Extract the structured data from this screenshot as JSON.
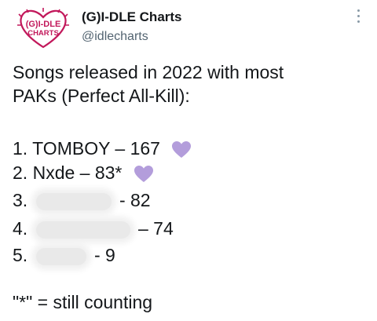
{
  "profile": {
    "display_name": "(G)I-DLE Charts",
    "handle": "@idlecharts",
    "avatar_text_line1": "(G)I-DLE",
    "avatar_text_line2": "CHARTS"
  },
  "tweet": {
    "headline_line1": "Songs released in 2022 with most",
    "headline_line2": "PAKs (Perfect All-Kill):",
    "items": [
      {
        "rank": "1.",
        "title": "TOMBOY",
        "value": "– 167",
        "heart": true,
        "redacted": false
      },
      {
        "rank": "2.",
        "title": "Nxde",
        "value": "– 83*",
        "heart": true,
        "redacted": false
      },
      {
        "rank": "3.",
        "title": "",
        "value": "- 82",
        "heart": false,
        "redacted": true
      },
      {
        "rank": "4.",
        "title": "",
        "value": "– 74",
        "heart": false,
        "redacted": true
      },
      {
        "rank": "5.",
        "title": "",
        "value": "- 9",
        "heart": false,
        "redacted": true
      }
    ],
    "footnote": "\"*\" = still counting"
  },
  "colors": {
    "heart": "#b39ddb",
    "avatar_accent": "#c2185b",
    "handle": "#536471"
  },
  "icons": {
    "more": "more-options-icon",
    "heart": "purple-heart-icon"
  }
}
